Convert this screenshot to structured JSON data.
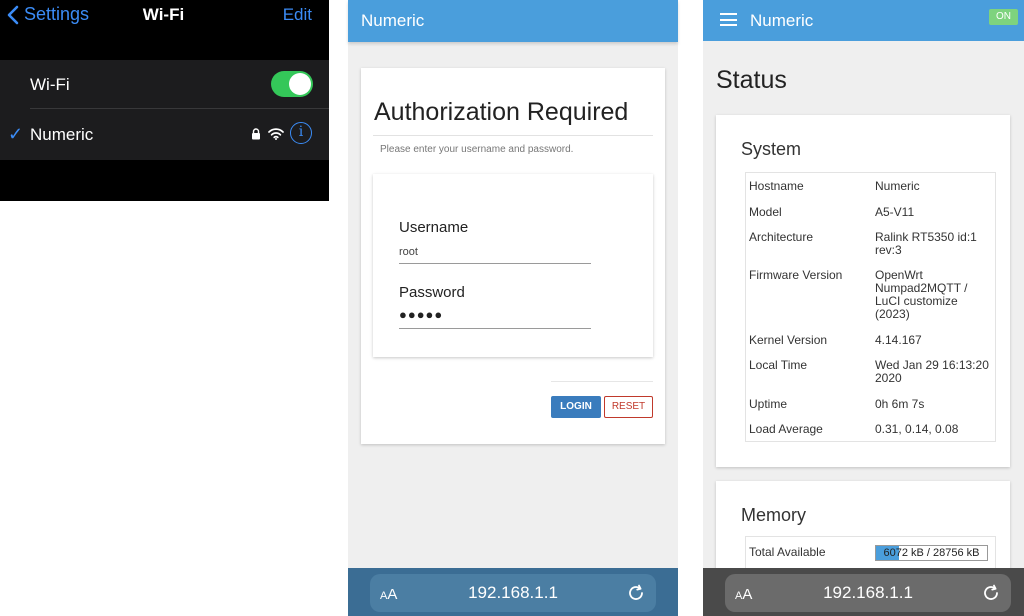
{
  "wifi_settings": {
    "back_label": "Settings",
    "title": "Wi-Fi",
    "edit_label": "Edit",
    "wifi_label": "Wi-Fi",
    "wifi_enabled": true,
    "network_name": "Numeric",
    "network_connected": true,
    "network_secured": true,
    "info_glyph": "i",
    "colors": {
      "accent": "#3b8cf6",
      "toggle_on": "#34c759"
    }
  },
  "login_page": {
    "brand": "Numeric",
    "title": "Authorization Required",
    "subtitle": "Please enter your username and password.",
    "username_label": "Username",
    "username_value": "root",
    "password_label": "Password",
    "password_value": "●●●●●",
    "login_label": "LOGIN",
    "reset_label": "RESET",
    "address_bar": {
      "aa_small": "A",
      "aa_large": "A",
      "url": "192.168.1.1"
    },
    "colors": {
      "header": "#4a9edc",
      "login_button": "#3a7cbd",
      "reset_text": "#c0392b"
    }
  },
  "status_page": {
    "brand": "Numeric",
    "badge": "ON",
    "title": "Status",
    "system_title": "System",
    "system_rows": [
      {
        "key": "Hostname",
        "value": "Numeric"
      },
      {
        "key": "Model",
        "value": "A5-V11"
      },
      {
        "key": "Architecture",
        "value": "Ralink RT5350 id:1 rev:3"
      },
      {
        "key": "Firmware Version",
        "value": "OpenWrt Numpad2MQTT / LuCI customize (2023)"
      },
      {
        "key": "Kernel Version",
        "value": "4.14.167"
      },
      {
        "key": "Local Time",
        "value": "Wed Jan 29 16:13:20 2020"
      },
      {
        "key": "Uptime",
        "value": "0h 6m 7s"
      },
      {
        "key": "Load Average",
        "value": "0.31, 0.14, 0.08"
      }
    ],
    "memory_title": "Memory",
    "memory_rows": [
      {
        "key": "Total Available",
        "value": "6072 kB / 28756 kB",
        "fraction": 0.21
      }
    ],
    "address_bar": {
      "aa_small": "A",
      "aa_large": "A",
      "url": "192.168.1.1"
    },
    "colors": {
      "header": "#4a9edc",
      "badge": "#7ed37e",
      "bar_fill": "#4a9edc"
    }
  }
}
